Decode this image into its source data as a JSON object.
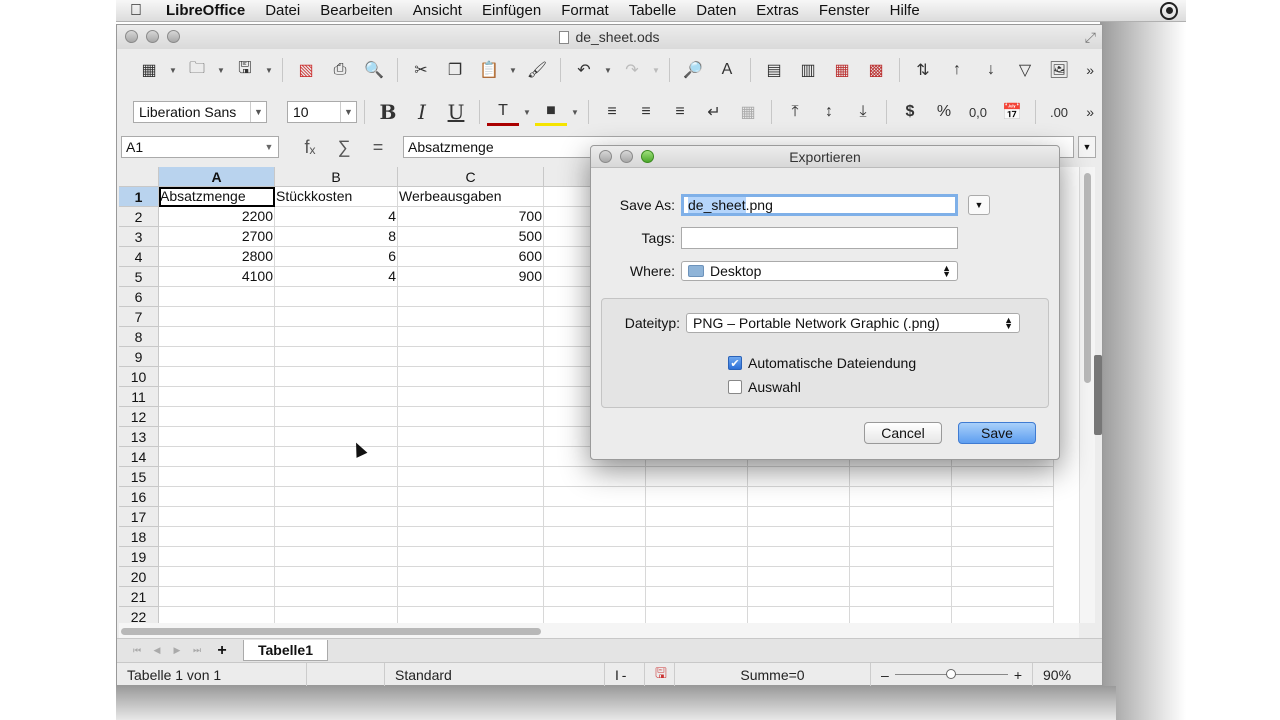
{
  "menubar": {
    "app_name": "LibreOffice",
    "items": [
      "Datei",
      "Bearbeiten",
      "Ansicht",
      "Einfügen",
      "Format",
      "Tabelle",
      "Daten",
      "Extras",
      "Fenster",
      "Hilfe"
    ]
  },
  "window": {
    "title": "de_sheet.ods"
  },
  "format_toolbar": {
    "font_name": "Liberation Sans",
    "font_size": "10"
  },
  "formula_bar": {
    "cell_ref": "A1",
    "content": "Absatzmenge",
    "fx": "fₓ",
    "sum": "∑",
    "equals": "="
  },
  "grid": {
    "columns": [
      "A",
      "B",
      "C"
    ],
    "rows": [
      "1",
      "2",
      "3",
      "4",
      "5",
      "6",
      "7",
      "8",
      "9",
      "10",
      "11",
      "12",
      "13",
      "14",
      "15",
      "16",
      "17",
      "18",
      "19",
      "20",
      "21",
      "22"
    ],
    "cells": [
      [
        "Absatzmenge",
        "Stückkosten",
        "Werbeausgaben"
      ],
      [
        "2200",
        "4",
        "700"
      ],
      [
        "2700",
        "8",
        "500"
      ],
      [
        "2800",
        "6",
        "600"
      ],
      [
        "4100",
        "4",
        "900"
      ]
    ]
  },
  "sheet_tabs": {
    "active": "Tabelle1",
    "add": "+"
  },
  "statusbar": {
    "sheet_info": "Tabelle 1 von 1",
    "style": "Standard",
    "sum": "Summe=0",
    "zoom": "90%",
    "zoom_minus": "–",
    "zoom_plus": "+"
  },
  "dialog": {
    "title": "Exportieren",
    "save_as_label": "Save As:",
    "save_as_selected": "de_sheet",
    "save_as_rest": ".png",
    "tags_label": "Tags:",
    "where_label": "Where:",
    "where_value": "Desktop",
    "filetype_label": "Dateityp:",
    "filetype_value": "PNG – Portable Network Graphic (.png)",
    "auto_extension": "Automatische Dateiendung",
    "selection": "Auswahl",
    "cancel": "Cancel",
    "save": "Save"
  }
}
